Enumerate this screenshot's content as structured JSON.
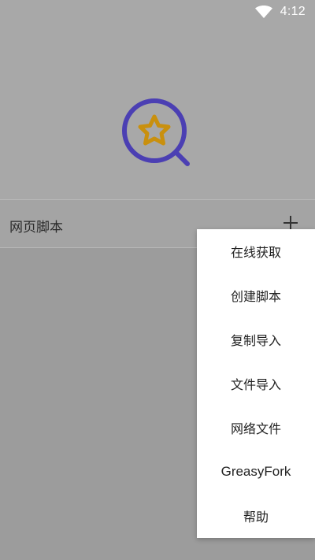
{
  "status_bar": {
    "time": "4:12",
    "wifi_icon": "wifi-icon"
  },
  "app": {
    "logo_icon": "search-star-logo-icon",
    "logo_colors": {
      "ring": "#4b3fb3",
      "star": "#c9900e"
    }
  },
  "scripts_bar": {
    "title": "网页脚本",
    "add_icon": "plus-icon"
  },
  "menu": {
    "items": [
      {
        "label": "在线获取"
      },
      {
        "label": "创建脚本"
      },
      {
        "label": "复制导入"
      },
      {
        "label": "文件导入"
      },
      {
        "label": "网络文件"
      },
      {
        "label": "GreasyFork"
      },
      {
        "label": "帮助"
      }
    ]
  }
}
